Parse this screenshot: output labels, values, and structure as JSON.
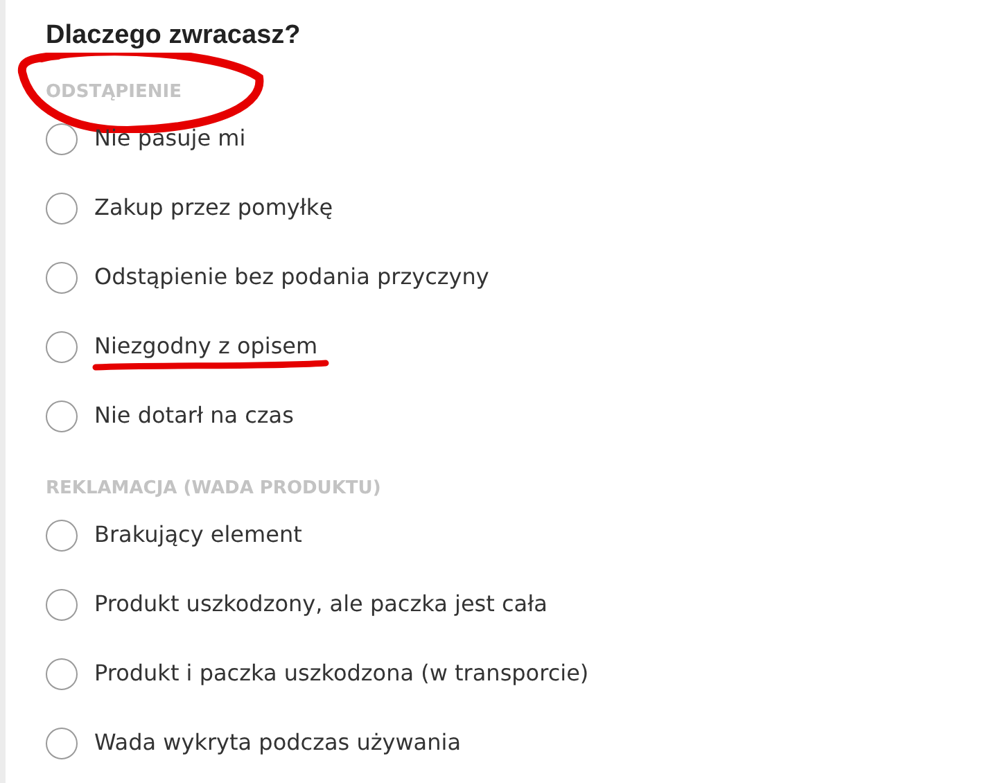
{
  "title": "Dlaczego zwracasz?",
  "sections": [
    {
      "heading": "ODSTĄPIENIE",
      "circled": true,
      "options": [
        {
          "label": "Nie pasuje mi",
          "selected": false,
          "underlined": false
        },
        {
          "label": "Zakup przez pomyłkę",
          "selected": false,
          "underlined": false
        },
        {
          "label": "Odstąpienie bez podania przyczyny",
          "selected": false,
          "underlined": false
        },
        {
          "label": "Niezgodny z opisem",
          "selected": false,
          "underlined": true
        },
        {
          "label": "Nie dotarł na czas",
          "selected": false,
          "underlined": false
        }
      ]
    },
    {
      "heading": "REKLAMACJA (WADA PRODUKTU)",
      "circled": false,
      "options": [
        {
          "label": "Brakujący element",
          "selected": false,
          "underlined": false
        },
        {
          "label": "Produkt uszkodzony, ale paczka jest cała",
          "selected": false,
          "underlined": false
        },
        {
          "label": "Produkt i paczka uszkodzona (w transporcie)",
          "selected": false,
          "underlined": false
        },
        {
          "label": "Wada wykryta podczas używania",
          "selected": false,
          "underlined": false
        }
      ]
    }
  ]
}
